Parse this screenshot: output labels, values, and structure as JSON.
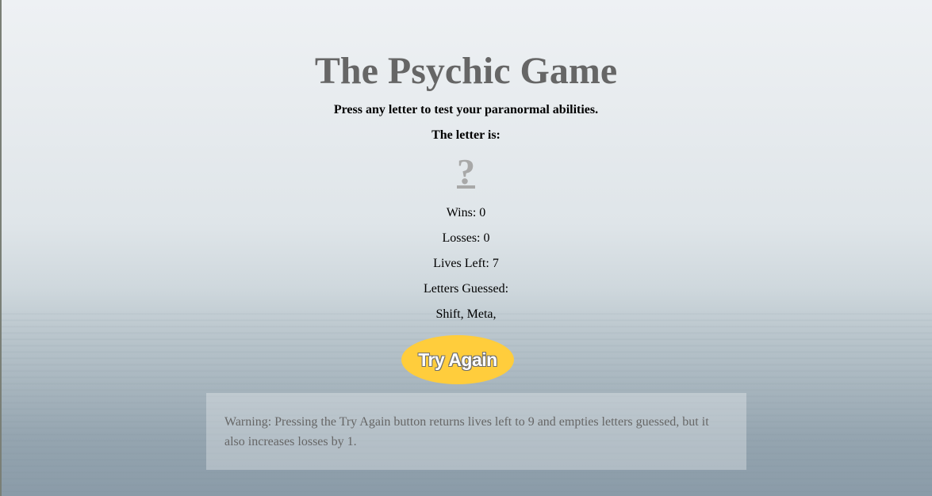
{
  "title": "The Psychic Game",
  "instructions": "Press any letter to test your paranormal abilities.",
  "letter_label": "The letter is:",
  "mystery_letter": "?",
  "stats": {
    "wins": "Wins: 0",
    "losses": "Losses: 0",
    "lives_left": "Lives Left: 7",
    "letters_guessed_label": "Letters Guessed:",
    "letters_guessed_value": "Shift, Meta,"
  },
  "button": {
    "label": "Try Again"
  },
  "warning": "Warning: Pressing the Try Again button returns lives left to 9 and empties letters guessed, but it also increases losses by 1.",
  "colors": {
    "title": "#666666",
    "button_bg": "#ffcd3c",
    "mystery": "#a8a8a8"
  }
}
